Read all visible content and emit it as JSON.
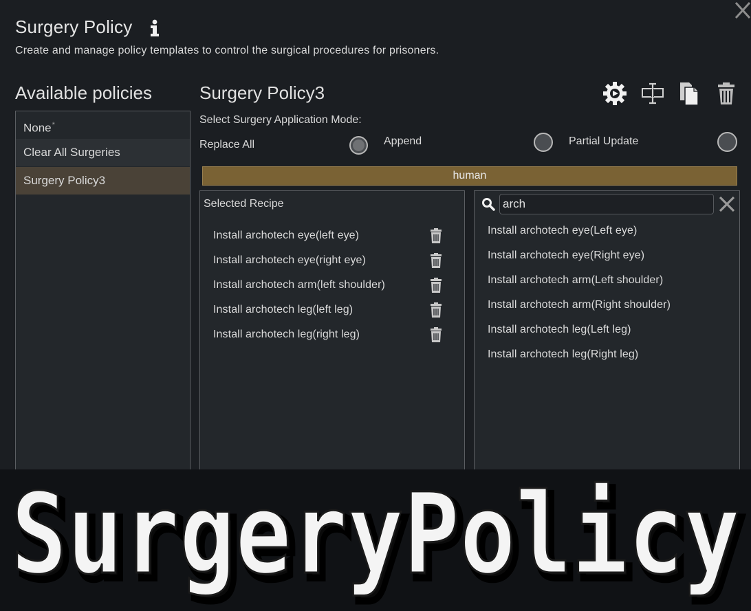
{
  "window": {
    "title": "Surgery Policy",
    "description": "Create and manage policy templates to control the surgical procedures for prisoners."
  },
  "policies": {
    "title": "Available policies",
    "items": [
      {
        "label": "None",
        "mark": "*"
      },
      {
        "label": "Clear All Surgeries",
        "mark": ""
      },
      {
        "label": "Surgery Policy3",
        "mark": ""
      }
    ],
    "selected_index": 2
  },
  "policy_editor": {
    "name": "Surgery Policy3",
    "mode_label": "Select Surgery Application Mode:",
    "modes": [
      {
        "label": "Replace All",
        "selected": true
      },
      {
        "label": "Append",
        "selected": false
      },
      {
        "label": "Partial Update",
        "selected": false
      }
    ],
    "race": "human",
    "toolbar": [
      "settings-icon",
      "rename-icon",
      "copy-icon",
      "delete-icon"
    ]
  },
  "selected_recipes": {
    "title": "Selected Recipe",
    "items": [
      "Install archotech eye(left eye)",
      "Install archotech eye(right eye)",
      "Install archotech arm(left shoulder)",
      "Install archotech leg(left leg)",
      "Install archotech leg(right leg)"
    ]
  },
  "available_recipes": {
    "search_value": "arch",
    "items": [
      "Install archotech eye(Left eye)",
      "Install archotech eye(Right eye)",
      "Install archotech arm(Left shoulder)",
      "Install archotech arm(Right shoulder)",
      "Install archotech leg(Left leg)",
      "Install archotech leg(Right leg)"
    ]
  },
  "banner": {
    "text": "SurgeryPolicy"
  },
  "colors": {
    "background": "#1b1e22",
    "panel": "#23272b",
    "selected_item": "#4a4237",
    "race_bar": "#7a6234"
  }
}
